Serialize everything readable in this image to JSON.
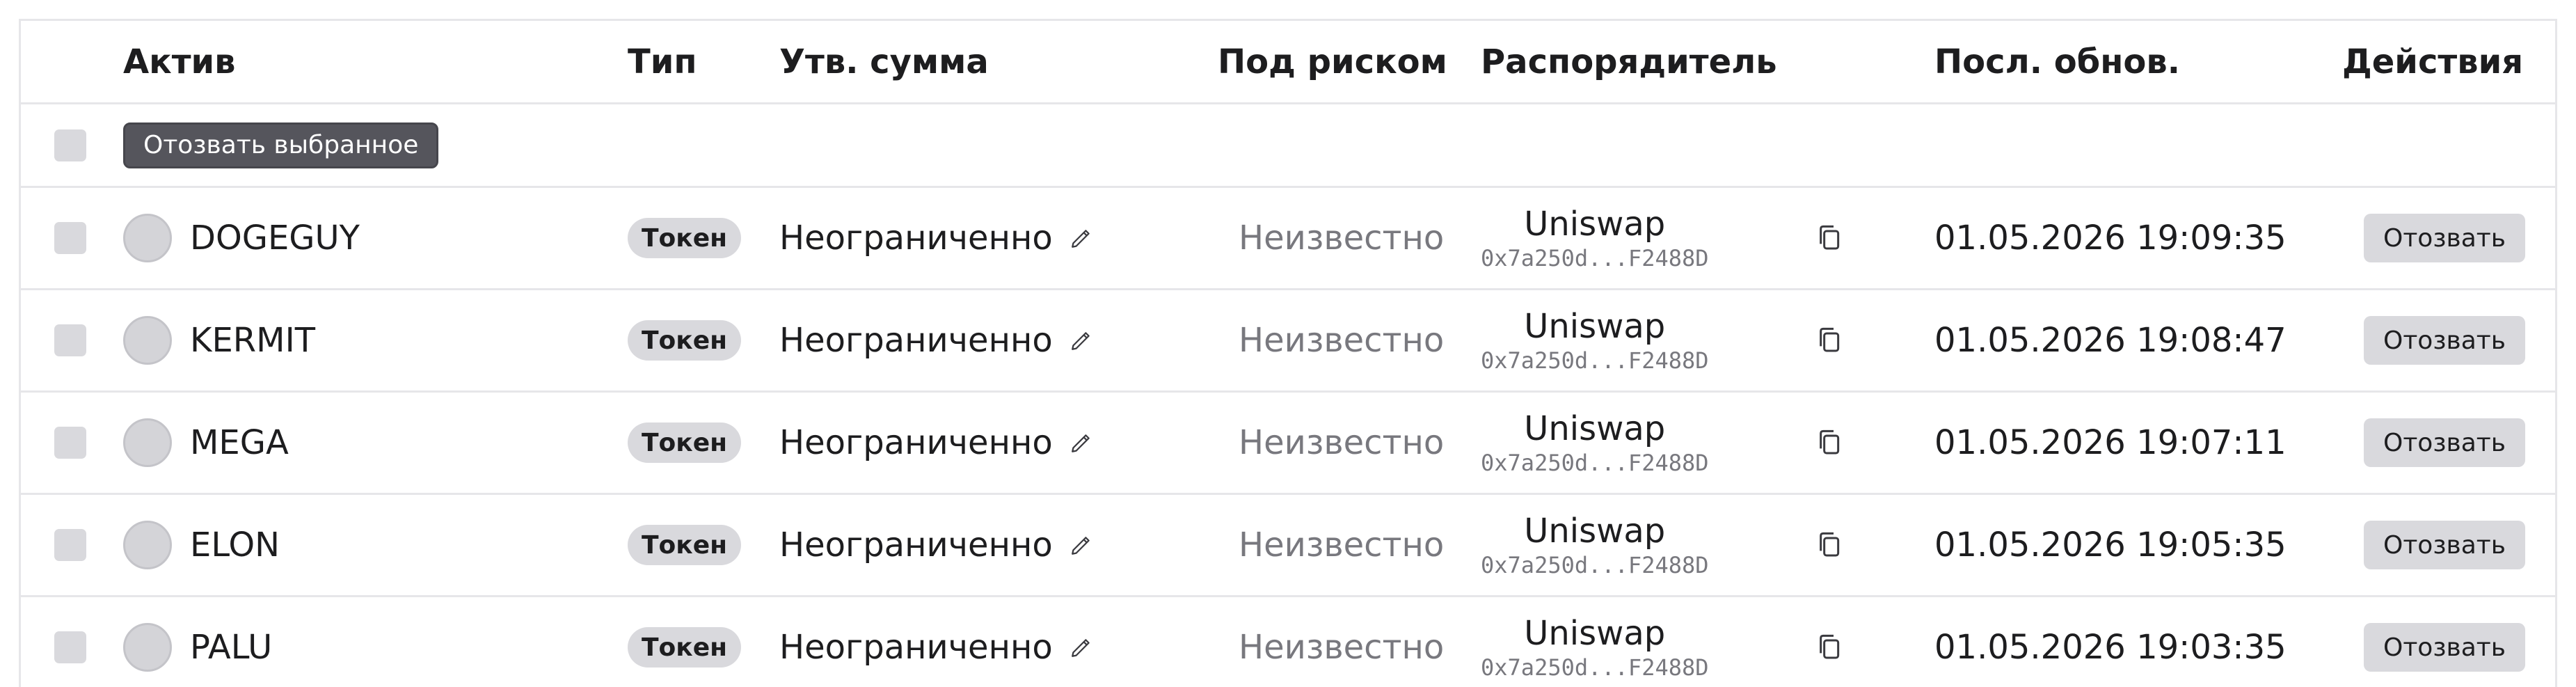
{
  "columns": {
    "asset": "Актив",
    "type": "Тип",
    "amount": "Утв. сумма",
    "risk": "Под риском",
    "spender": "Распорядитель",
    "updated": "Посл. обнов.",
    "actions": "Действия"
  },
  "bulk": {
    "revoke_selected_label": "Отозвать выбранное"
  },
  "rows": [
    {
      "asset": "DOGEGUY",
      "type": "Токен",
      "amount": "Неограниченно",
      "risk": "Неизвестно",
      "spender_name": "Uniswap",
      "spender_address": "0x7a250d...F2488D",
      "updated": "01.05.2026 19:09:35",
      "revoke_label": "Отозвать"
    },
    {
      "asset": "KERMIT",
      "type": "Токен",
      "amount": "Неограниченно",
      "risk": "Неизвестно",
      "spender_name": "Uniswap",
      "spender_address": "0x7a250d...F2488D",
      "updated": "01.05.2026 19:08:47",
      "revoke_label": "Отозвать"
    },
    {
      "asset": "MEGA",
      "type": "Токен",
      "amount": "Неограниченно",
      "risk": "Неизвестно",
      "spender_name": "Uniswap",
      "spender_address": "0x7a250d...F2488D",
      "updated": "01.05.2026 19:07:11",
      "revoke_label": "Отозвать"
    },
    {
      "asset": "ELON",
      "type": "Токен",
      "amount": "Неограниченно",
      "risk": "Неизвестно",
      "spender_name": "Uniswap",
      "spender_address": "0x7a250d...F2488D",
      "updated": "01.05.2026 19:05:35",
      "revoke_label": "Отозвать"
    },
    {
      "asset": "PALU",
      "type": "Токен",
      "amount": "Неограниченно",
      "risk": "Неизвестно",
      "spender_name": "Uniswap",
      "spender_address": "0x7a250d...F2488D",
      "updated": "01.05.2026 19:03:35",
      "revoke_label": "Отозвать"
    }
  ]
}
